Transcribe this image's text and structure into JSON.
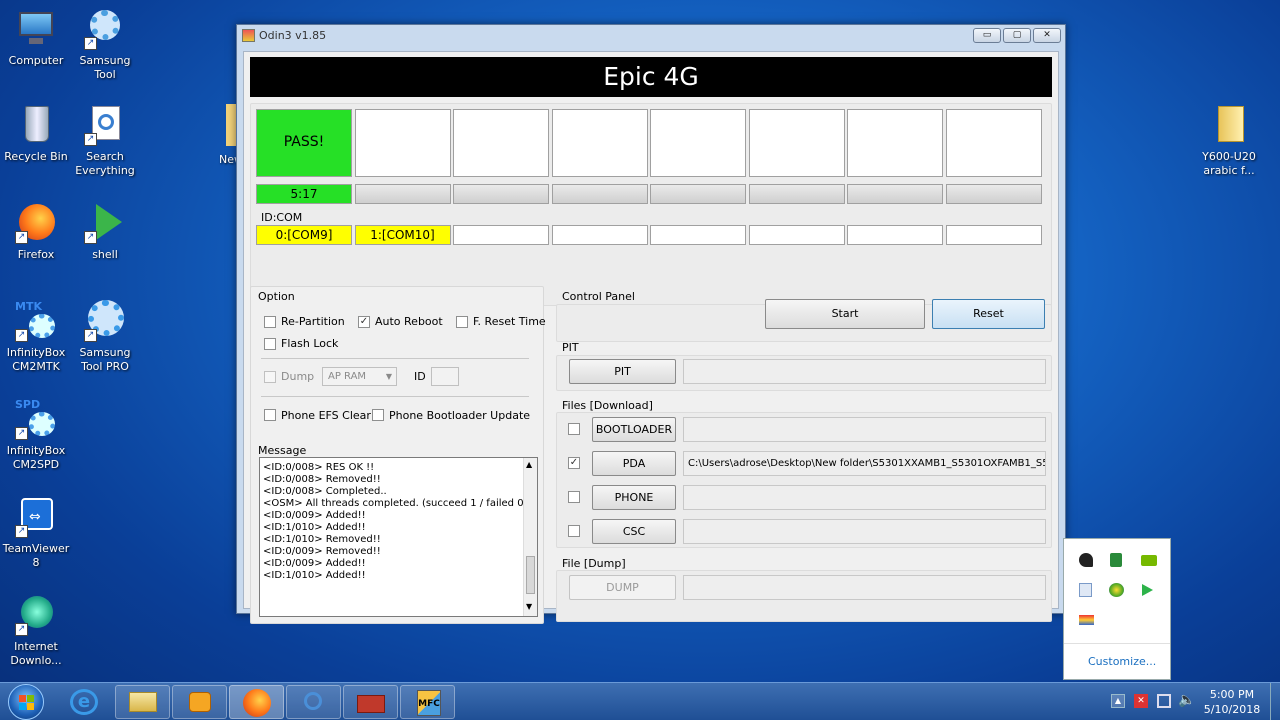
{
  "desktop": {
    "left_icons": [
      {
        "label": "Computer",
        "icon": "computer-icon"
      },
      {
        "label": "Samsung Tool",
        "icon": "gear-icon"
      },
      {
        "label": "Recycle Bin",
        "icon": "recycle-bin-icon"
      },
      {
        "label": "Search Everything",
        "icon": "search-icon"
      },
      {
        "label": "Firefox",
        "icon": "firefox-icon"
      },
      {
        "label": "shell",
        "icon": "play-icon"
      },
      {
        "label": "InfinityBox CM2MTK",
        "icon": "infinitybox-icon",
        "badge": "MTK"
      },
      {
        "label": "Samsung Tool PRO",
        "icon": "gear-icon"
      },
      {
        "label": "InfinityBox CM2SPD",
        "icon": "infinitybox-icon",
        "badge": "SPD"
      },
      {
        "label": "TeamViewer 8",
        "icon": "teamviewer-icon"
      },
      {
        "label": "Internet Downlo...",
        "icon": "download-icon"
      }
    ],
    "partial_icon_label": "New",
    "right_icon": {
      "label": "Y600-U20 arabic f...",
      "icon": "folder-icon"
    }
  },
  "window": {
    "title": "Odin3 v1.85",
    "min": "▭",
    "max": "▢",
    "close": "✕",
    "model": "Epic 4G",
    "slots": [
      {
        "status": "PASS!",
        "progress": "5:17",
        "com": "0:[COM9]"
      },
      {
        "status": "",
        "progress": "",
        "com": "1:[COM10]"
      },
      {
        "status": "",
        "progress": "",
        "com": ""
      },
      {
        "status": "",
        "progress": "",
        "com": ""
      },
      {
        "status": "",
        "progress": "",
        "com": ""
      },
      {
        "status": "",
        "progress": "",
        "com": ""
      },
      {
        "status": "",
        "progress": "",
        "com": ""
      },
      {
        "status": "",
        "progress": "",
        "com": ""
      }
    ],
    "idcom_label": "ID:COM",
    "option": {
      "title": "Option",
      "re_partition": "Re-Partition",
      "auto_reboot": "Auto Reboot",
      "f_reset_time": "F. Reset Time",
      "flash_lock": "Flash Lock",
      "dump": "Dump",
      "ap_ram": "AP RAM",
      "id": "ID",
      "phone_efs_clear": "Phone EFS Clear",
      "phone_bootloader_update": "Phone Bootloader Update",
      "checked_auto_reboot": "✓"
    },
    "message": {
      "title": "Message",
      "lines": [
        "<ID:0/008> RES OK !!",
        "<ID:0/008> Removed!!",
        "<ID:0/008> Completed..",
        "<OSM> All threads completed. (succeed 1 / failed 0)",
        "<ID:0/009> Added!!",
        "<ID:1/010> Added!!",
        "<ID:1/010> Removed!!",
        "<ID:0/009> Removed!!",
        "<ID:0/009> Added!!",
        "<ID:1/010> Added!!"
      ]
    },
    "control_panel": {
      "title": "Control Panel",
      "start": "Start",
      "reset": "Reset"
    },
    "pit": {
      "title": "PIT",
      "button": "PIT"
    },
    "files": {
      "title": "Files [Download]",
      "bootloader": "BOOTLOADER",
      "pda": "PDA",
      "phone": "PHONE",
      "csc": "CSC",
      "pda_path": "C:\\Users\\adrose\\Desktop\\New folder\\S5301XXAMB1_S5301OXFAMB1_S5301X",
      "pda_checked": "✓"
    },
    "file_dump": {
      "title": "File [Dump]",
      "button": "DUMP"
    }
  },
  "tray_popup": {
    "customize": "Customize..."
  },
  "taskbar": {
    "time": "5:00 PM",
    "date": "5/10/2018"
  },
  "colors": {
    "pass": "#26e026",
    "com_active": "#ffff00",
    "model_bg": "#000000"
  }
}
